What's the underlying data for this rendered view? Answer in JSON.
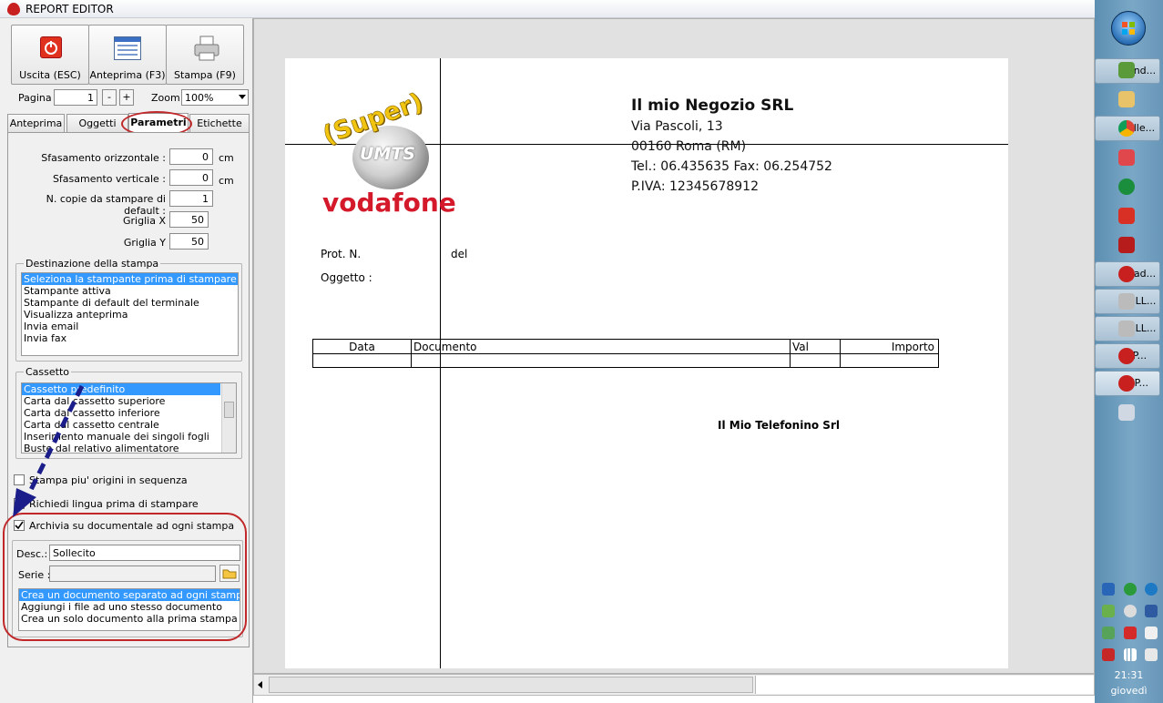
{
  "window": {
    "title": "REPORT EDITOR"
  },
  "toolbar": {
    "exit_label": "Uscita (ESC)",
    "preview_label": "Anteprima (F3)",
    "print_label": "Stampa (F9)"
  },
  "nav": {
    "page_label": "Pagina",
    "page_value": "1",
    "minus": "-",
    "plus": "+",
    "zoom_label": "Zoom",
    "zoom_value": "100%"
  },
  "tabs": [
    "Anteprima",
    "Oggetti",
    "Parametri",
    "Etichette"
  ],
  "params": {
    "rows": [
      {
        "label": "Sfasamento orizzontale :",
        "value": "0",
        "unit": "cm"
      },
      {
        "label": "Sfasamento verticale :",
        "value": "0",
        "unit": "cm"
      },
      {
        "label": "N. copie da stampare di default :",
        "value": "1",
        "unit": ""
      },
      {
        "label": "Griglia X",
        "value": "50",
        "unit": ""
      },
      {
        "label": "Griglia Y",
        "value": "50",
        "unit": ""
      }
    ]
  },
  "destination": {
    "title": "Destinazione della stampa",
    "items": [
      "Seleziona la stampante prima di stampare",
      "Stampante attiva",
      "Stampante di default del terminale",
      "Visualizza anteprima",
      "Invia email",
      "Invia fax"
    ]
  },
  "drawer": {
    "title": "Cassetto",
    "items": [
      "Cassetto predefinito",
      "Carta dal cassetto superiore",
      "Carta dal cassetto inferiore",
      "Carta dal cassetto centrale",
      "Inserimento manuale dei singoli fogli",
      "Buste dal relativo alimentatore"
    ]
  },
  "checks": {
    "multi_origin": "Stampa piu' origini in sequenza",
    "ask_language": "Richiedi lingua prima di stampare",
    "archive": "Archivia su documentale ad ogni stampa"
  },
  "archive": {
    "desc_label": "Desc.:",
    "desc_value": "Sollecito",
    "serie_label": "Serie :",
    "options": [
      "Crea un documento separato ad ogni stampa",
      "Aggiungi i file ad uno stesso documento",
      "Crea un solo documento alla prima stampa"
    ]
  },
  "report": {
    "logo_super": "(Super)",
    "logo_umts": "UMTS",
    "logo_brand": "vodafone",
    "company": "Il mio Negozio SRL",
    "address": "Via Pascoli, 13",
    "city": "00160 Roma (RM)",
    "phone": "Tel.: 06.435635 Fax: 06.254752",
    "vat": "P.IVA: 12345678912",
    "prot": "Prot. N.",
    "del": "del",
    "subject": "Oggetto :",
    "table_headers": [
      "Data",
      "Documento",
      "Val",
      "Importo"
    ],
    "signature": "Il Mio Telefonino Srl"
  },
  "taskbar": {
    "items": [
      "Wind...",
      "Solle...",
      "Read...",
      "SOLL...",
      "SOLL...",
      "IMP...",
      "REP..."
    ],
    "clock": "21:31",
    "day": "giovedì"
  }
}
